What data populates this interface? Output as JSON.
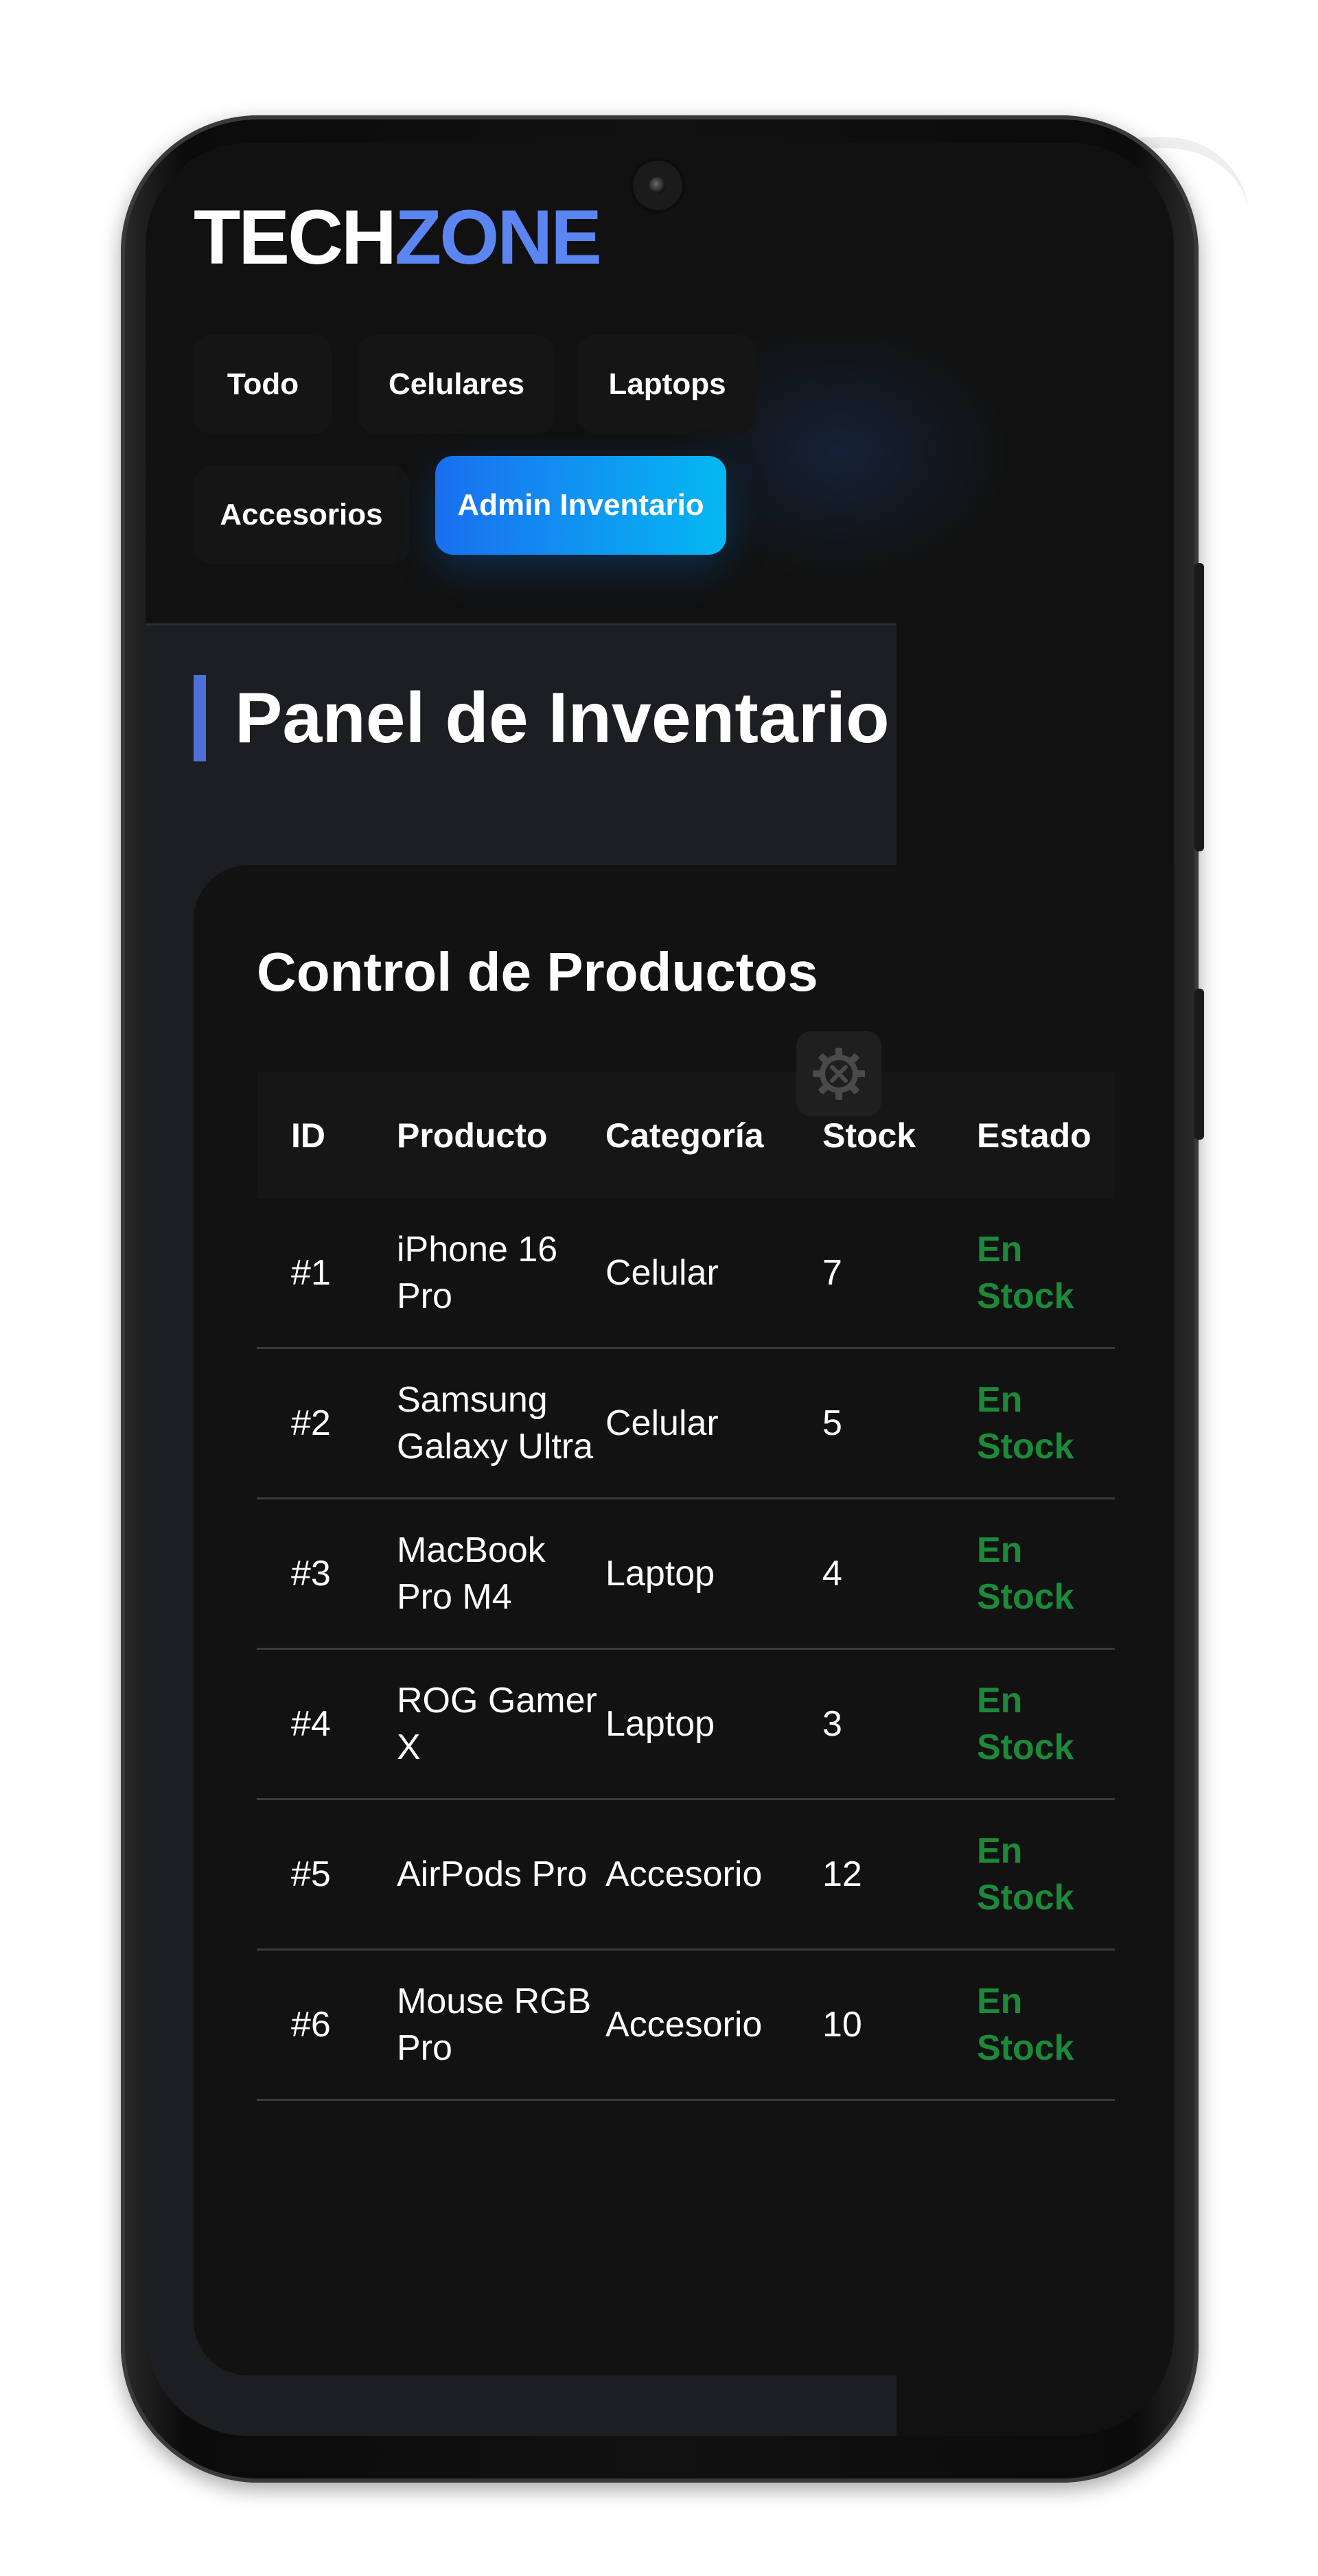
{
  "app": {
    "logo_part1": "TECH",
    "logo_part2": "ZONE"
  },
  "nav": {
    "items": [
      {
        "label": "Todo"
      },
      {
        "label": "Celulares"
      },
      {
        "label": "Laptops"
      },
      {
        "label": "Accesorios"
      },
      {
        "label": "Admin Inventario",
        "active": true
      }
    ]
  },
  "panel": {
    "title": "Panel de Inventario"
  },
  "card": {
    "title": "Control de Productos",
    "settings_icon": "gear-wrench-icon"
  },
  "table": {
    "headers": [
      "ID",
      "Producto",
      "Categoría",
      "Stock",
      "Estado"
    ],
    "rows": [
      {
        "id": "#1",
        "product": "iPhone 16 Pro",
        "category": "Celular",
        "stock": "7",
        "status": "En Stock"
      },
      {
        "id": "#2",
        "product": "Samsung Galaxy Ultra",
        "category": "Celular",
        "stock": "5",
        "status": "En Stock"
      },
      {
        "id": "#3",
        "product": "MacBook Pro M4",
        "category": "Laptop",
        "stock": "4",
        "status": "En Stock"
      },
      {
        "id": "#4",
        "product": "ROG Gamer X",
        "category": "Laptop",
        "stock": "3",
        "status": "En Stock"
      },
      {
        "id": "#5",
        "product": "AirPods Pro",
        "category": "Accesorio",
        "stock": "12",
        "status": "En Stock"
      },
      {
        "id": "#6",
        "product": "Mouse RGB Pro",
        "category": "Accesorio",
        "stock": "10",
        "status": "En Stock"
      }
    ]
  },
  "colors": {
    "accent_blue": "#5b86f2",
    "active_gradient_start": "#1a6ff0",
    "active_gradient_end": "#06b8f2",
    "status_green": "#1c8a3a",
    "screen_bg": "#111111"
  }
}
